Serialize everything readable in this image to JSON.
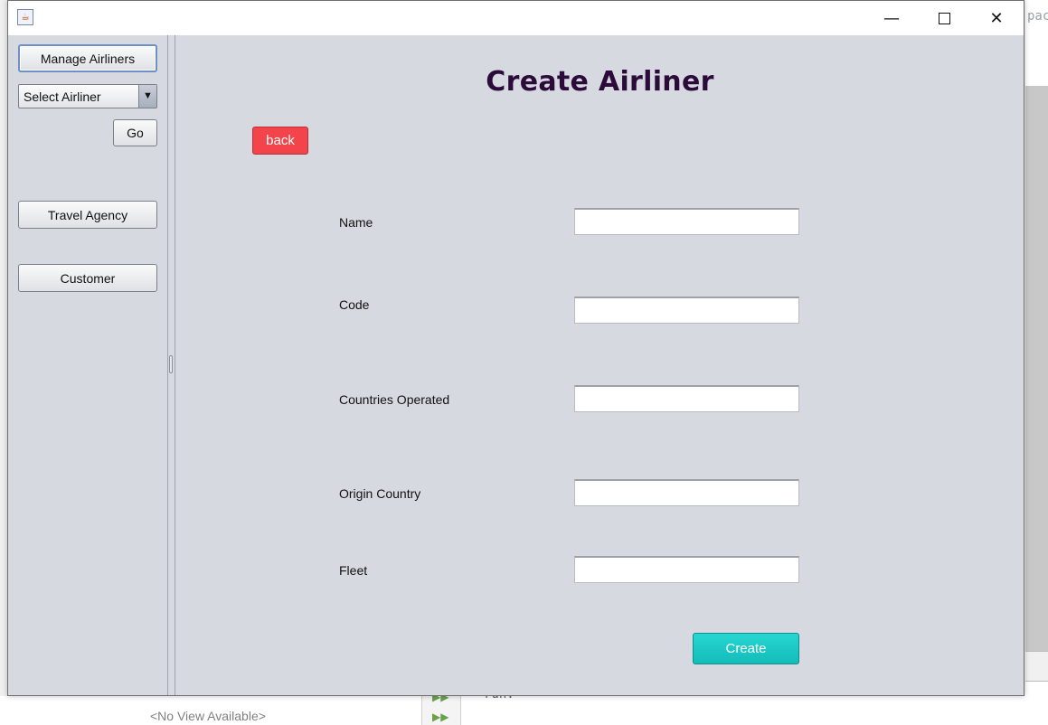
{
  "background": {
    "right_text": "pack",
    "no_view": "<No View Available>",
    "code_text": "run:"
  },
  "window": {
    "title": "",
    "icon": "java-coffee-icon"
  },
  "sidebar": {
    "manage_airliners": "Manage Airliners",
    "select_airliner": "Select Airliner",
    "go": "Go",
    "travel_agency": "Travel Agency",
    "customer": "Customer"
  },
  "main": {
    "title": "Create Airliner",
    "back": "back",
    "fields": {
      "name": {
        "label": "Name",
        "value": ""
      },
      "code": {
        "label": "Code",
        "value": ""
      },
      "countries": {
        "label": "Countries Operated",
        "value": ""
      },
      "origin": {
        "label": "Origin Country",
        "value": ""
      },
      "fleet": {
        "label": "Fleet",
        "value": ""
      }
    },
    "create": "Create"
  },
  "colors": {
    "panel_bg": "#d6d9e0",
    "title_color": "#2c0b3a",
    "back_button": "#f2444a",
    "create_button": "#1cc9c5"
  }
}
